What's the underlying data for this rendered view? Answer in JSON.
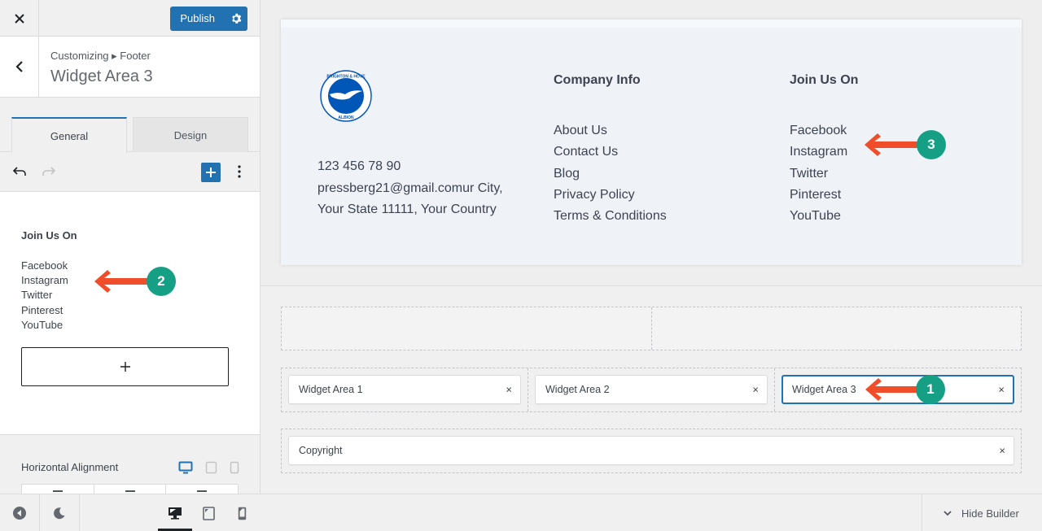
{
  "topbar": {
    "close_icon": "close-icon",
    "publish_label": "Publish",
    "settings_icon": "gear-icon"
  },
  "section": {
    "breadcrumb": "Customizing ▸ Footer",
    "title": "Widget Area 3"
  },
  "tabs": [
    {
      "label": "General",
      "active": true
    },
    {
      "label": "Design",
      "active": false
    }
  ],
  "toolbar": {
    "undo_icon": "undo-icon",
    "redo_icon": "redo-icon",
    "add_block_icon": "plus-icon",
    "more_icon": "more-vertical-icon"
  },
  "editor": {
    "heading": "Join Us On",
    "list": [
      "Facebook",
      "Instagram",
      "Twitter",
      "Pinterest",
      "YouTube"
    ],
    "add_block_symbol": "+"
  },
  "settings": {
    "horizontal_alignment_label": "Horizontal Alignment",
    "device_icons": [
      "desktop-icon",
      "tablet-icon",
      "mobile-icon"
    ],
    "active_device": "desktop"
  },
  "footer_bar": {
    "icons": [
      "collapse-icon",
      "dark-mode-icon",
      "desktop-icon",
      "tablet-icon",
      "mobile-icon"
    ],
    "hide_builder_label": "Hide Builder"
  },
  "preview": {
    "logo_alt": "Brighton & Hove Albion",
    "logo_text_top": "BRIGHTON & HOVE",
    "logo_text_bottom": "ALBION",
    "contact": {
      "phone": "123 456 78 90",
      "line2": "pressberg21@gmail.comur City,",
      "line3": "Your State 11111, Your Country"
    },
    "company_info": {
      "title": "Company Info",
      "links": [
        "About Us",
        "Contact Us",
        "Blog",
        "Privacy Policy",
        "Terms & Conditions"
      ]
    },
    "join_us": {
      "title": "Join Us On",
      "links": [
        "Facebook",
        "Instagram",
        "Twitter",
        "Pinterest",
        "YouTube"
      ]
    }
  },
  "builder": {
    "main_row": [
      {
        "label": "Widget Area 1",
        "selected": false
      },
      {
        "label": "Widget Area 2",
        "selected": false
      },
      {
        "label": "Widget Area 3",
        "selected": true
      }
    ],
    "bottom_row": [
      {
        "label": "Copyright"
      }
    ],
    "remove_symbol": "×"
  },
  "annotations": [
    {
      "number": "1",
      "target": "Widget Area 3 builder item"
    },
    {
      "number": "2",
      "target": "Instagram in sidebar editor"
    },
    {
      "number": "3",
      "target": "Instagram in preview footer"
    }
  ],
  "colors": {
    "accent": "#2271b1",
    "annotation_badge": "#15a085",
    "annotation_arrow": "#f04e2a"
  }
}
